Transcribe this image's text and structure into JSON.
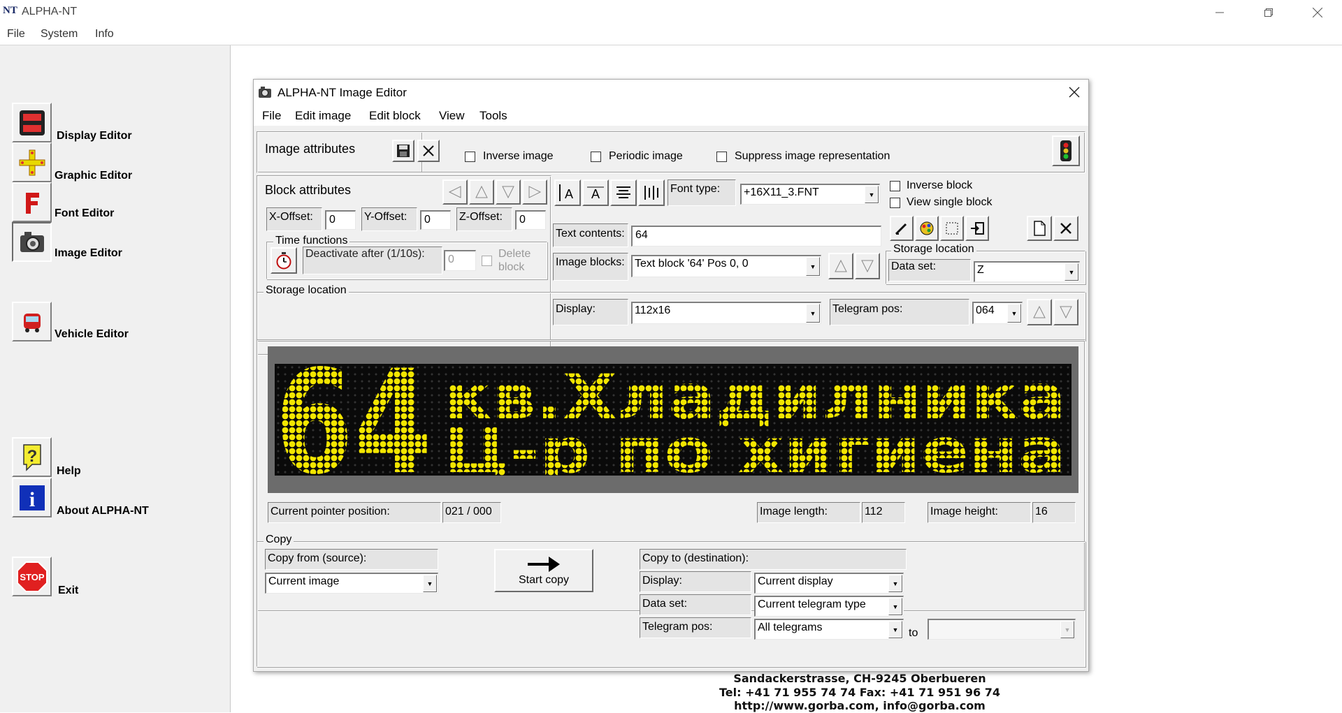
{
  "app": {
    "icon_text": "NT",
    "title": "ALPHA-NT",
    "menu": [
      "File",
      "System",
      "Info"
    ]
  },
  "sidebar": {
    "items": [
      {
        "label": "Display Editor",
        "icon": "display-editor-icon"
      },
      {
        "label": "Graphic Editor",
        "icon": "graphic-editor-icon"
      },
      {
        "label": "Font Editor",
        "icon": "font-editor-icon"
      },
      {
        "label": "Image Editor",
        "icon": "camera-icon"
      },
      {
        "label": "Vehicle Editor",
        "icon": "vehicle-icon"
      },
      {
        "label": "Help",
        "icon": "help-icon"
      },
      {
        "label": "About ALPHA-NT",
        "icon": "info-icon"
      },
      {
        "label": "Exit",
        "icon": "stop-icon"
      }
    ],
    "stop_text": "STOP"
  },
  "editor": {
    "title": "ALPHA-NT Image Editor",
    "menu": [
      "File",
      "Edit image",
      "Edit block",
      "View",
      "Tools"
    ],
    "image_attributes": {
      "label": "Image attributes",
      "inverse_image": "Inverse image",
      "periodic_image": "Periodic image",
      "suppress": "Suppress image representation"
    },
    "block_attributes": {
      "label": "Block attributes",
      "x_offset_label": "X-Offset:",
      "x_offset": "0",
      "y_offset_label": "Y-Offset:",
      "y_offset": "0",
      "z_offset_label": "Z-Offset:",
      "z_offset": "0",
      "time_functions": "Time functions",
      "deactivate_label": "Deactivate after (1/10s):",
      "deactivate_value": "0",
      "delete_block_1": "Delete",
      "delete_block_2": "block"
    },
    "font_type_label": "Font type:",
    "font_type": "+16X11_3.FNT",
    "inverse_block": "Inverse block",
    "view_single_block": "View single block",
    "text_contents_label": "Text contents:",
    "text_contents": "64",
    "image_blocks_label": "Image blocks:",
    "image_blocks": "Text block '64' Pos 0, 0",
    "storage_location": {
      "label": "Storage location",
      "data_set_label": "Data set:",
      "data_set": "Z",
      "display_label": "Display:",
      "display": "112x16",
      "telegram_pos_label": "Telegram pos:",
      "telegram_pos": "064"
    },
    "led": {
      "route": "64",
      "line1": "кв.Хладилника",
      "line2": "Ц-р по хигиена",
      "color": "#f3e600"
    },
    "status": {
      "pointer_label": "Current pointer position:",
      "pointer_value": "021 / 000",
      "length_label": "Image length:",
      "length_value": "112",
      "height_label": "Image height:",
      "height_value": "16"
    },
    "copy": {
      "label": "Copy",
      "from_label": "Copy from (source):",
      "from_value": "Current image",
      "start_copy": "Start copy",
      "to_label": "Copy to (destination):",
      "display_label": "Display:",
      "display_value": "Current display",
      "data_set_label": "Data set:",
      "data_set_value": "Current telegram type",
      "telegram_label": "Telegram pos:",
      "telegram_value": "All telegrams",
      "to": "to",
      "to_value": ""
    }
  },
  "footer": {
    "line1": "Sandackerstrasse, CH-9245 Oberbueren",
    "line2": "Tel: +41 71 955 74 74  Fax: +41 71 951 96 74",
    "line3": "http://www.gorba.com, info@gorba.com"
  }
}
